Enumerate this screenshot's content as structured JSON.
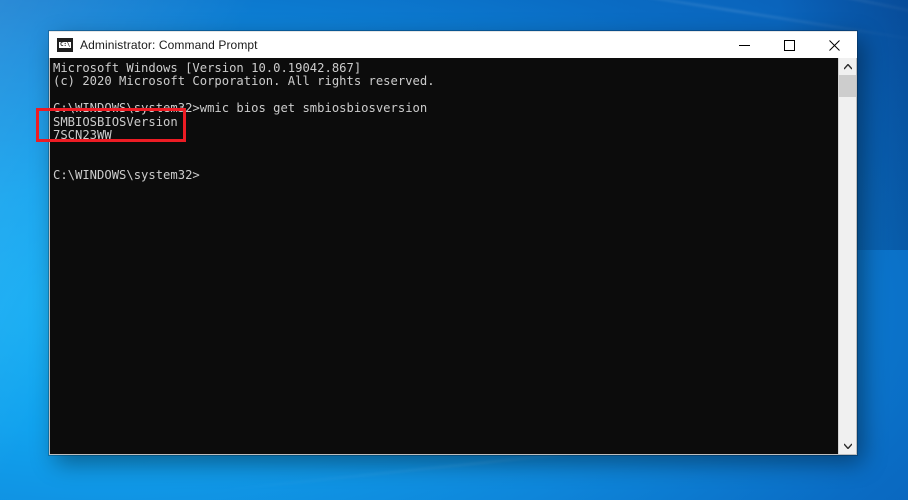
{
  "window": {
    "title": "Administrator: Command Prompt",
    "icon_name": "command-prompt-icon",
    "icon_glyph": "C:\\",
    "controls": {
      "minimize_label": "Minimize",
      "maximize_label": "Maximize",
      "close_label": "Close"
    }
  },
  "console": {
    "background_color": "#0c0c0c",
    "text_color": "#cccccc",
    "lines": [
      "Microsoft Windows [Version 10.0.19042.867]",
      "(c) 2020 Microsoft Corporation. All rights reserved.",
      "",
      "C:\\WINDOWS\\system32>wmic bios get smbiosbiosversion",
      "SMBIOSBIOSVersion",
      "7SCN23WW",
      "",
      "",
      "C:\\WINDOWS\\system32>"
    ],
    "prompt": "C:\\WINDOWS\\system32>",
    "command": "wmic bios get smbiosbiosversion",
    "output_header": "SMBIOSBIOSVersion",
    "output_value": "7SCN23WW"
  },
  "scrollbar": {
    "up_arrow": "▲",
    "down_arrow": "▼"
  },
  "annotation": {
    "highlight_color": "#ed1c24",
    "highlight_target": "SMBIOSBIOSVersion / 7SCN23WW"
  },
  "desktop": {
    "wallpaper_name": "windows-10-blue-hero-wallpaper",
    "primary_color": "#0d7fd4",
    "accent_color": "#17b0f5"
  }
}
